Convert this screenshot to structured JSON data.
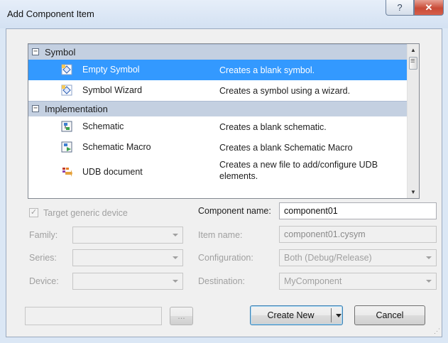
{
  "window": {
    "title": "Add Component Item",
    "help_glyph": "?",
    "close_glyph": "✕"
  },
  "list": {
    "groups": [
      {
        "label": "Symbol",
        "expander": "−",
        "items": [
          {
            "name": "Empty Symbol",
            "description": "Creates a blank symbol.",
            "icon": "symbol-icon",
            "selected": true
          },
          {
            "name": "Symbol Wizard",
            "description": "Creates a symbol using a wizard.",
            "icon": "symbol-wizard-icon",
            "selected": false
          }
        ]
      },
      {
        "label": "Implementation",
        "expander": "−",
        "items": [
          {
            "name": "Schematic",
            "description": "Creates a blank schematic.",
            "icon": "schematic-icon",
            "selected": false
          },
          {
            "name": "Schematic Macro",
            "description": "Creates a blank Schematic Macro",
            "icon": "schematic-macro-icon",
            "selected": false
          },
          {
            "name": "UDB document",
            "description": "Creates a new file to add/configure UDB elements.",
            "icon": "udb-document-icon",
            "selected": false
          }
        ]
      }
    ]
  },
  "form": {
    "target_generic_label": "Target generic device",
    "target_generic_checked": true,
    "family_label": "Family:",
    "family_value": "",
    "series_label": "Series:",
    "series_value": "",
    "device_label": "Device:",
    "device_value": "",
    "component_name_label": "Component name:",
    "component_name_value": "component01",
    "item_name_label": "Item name:",
    "item_name_value": "component01.cysym",
    "configuration_label": "Configuration:",
    "configuration_value": "Both (Debug/Release)",
    "destination_label": "Destination:",
    "destination_value": "MyComponent"
  },
  "bottom": {
    "path_value": "",
    "browse_label": "...",
    "create_label": "Create New",
    "cancel_label": "Cancel"
  },
  "colors": {
    "selection": "#3399ff",
    "group_header": "#c4d0e1",
    "close_button": "#c94a36"
  }
}
